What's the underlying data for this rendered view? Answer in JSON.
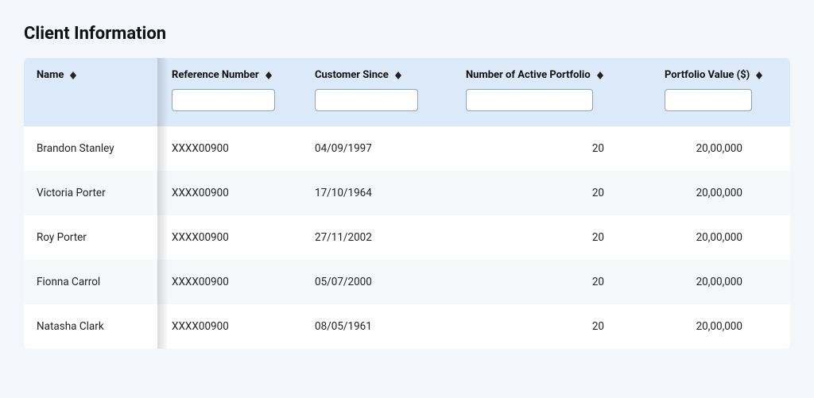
{
  "title": "Client Information",
  "columns": {
    "name": {
      "label": "Name"
    },
    "ref": {
      "label": "Reference Number"
    },
    "since": {
      "label": "Customer Since"
    },
    "active": {
      "label": "Number of Active Portfolio"
    },
    "value": {
      "label": "Portfolio Value ($)"
    }
  },
  "rows": [
    {
      "name": "Brandon Stanley",
      "ref": "XXXX00900",
      "since": "04/09/1997",
      "active": "20",
      "value": "20,00,000"
    },
    {
      "name": "Victoria Porter",
      "ref": "XXXX00900",
      "since": "17/10/1964",
      "active": "20",
      "value": "20,00,000"
    },
    {
      "name": "Roy Porter",
      "ref": "XXXX00900",
      "since": "27/11/2002",
      "active": "20",
      "value": "20,00,000"
    },
    {
      "name": "Fionna Carrol",
      "ref": "XXXX00900",
      "since": "05/07/2000",
      "active": "20",
      "value": "20,00,000"
    },
    {
      "name": "Natasha Clark",
      "ref": "XXXX00900",
      "since": "08/05/1961",
      "active": "20",
      "value": "20,00,000"
    }
  ]
}
